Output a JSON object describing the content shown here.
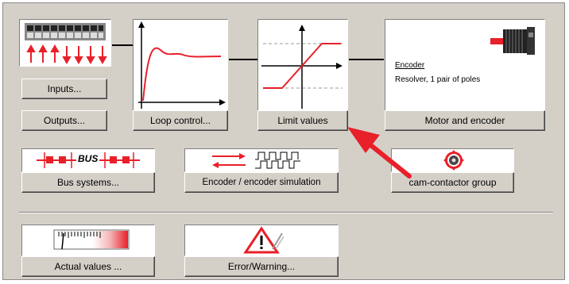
{
  "buttons": {
    "inputs": "Inputs...",
    "outputs": "Outputs...",
    "loop_control": "Loop control...",
    "limit_values": "Limit values",
    "motor_and_encoder": "Motor and encoder",
    "bus_systems": "Bus systems...",
    "encoder_simulation": "Encoder / encoder simulation",
    "cam_contactor_group": "cam-contactor group",
    "actual_values": "Actual values ...",
    "error_warning": "Error/Warning..."
  },
  "motor_panel": {
    "encoder_heading": "Encoder",
    "encoder_type": "Resolver, 1 pair of poles"
  },
  "bus_icon_label": "BUS",
  "icons": [
    "io-terminal-icon",
    "loop-response-graph-icon",
    "limit-graph-icon",
    "motor-icon",
    "bus-icon",
    "encoder-signal-icon",
    "cam-icon",
    "gauge-icon",
    "warning-triangle-icon",
    "red-arrow-icon"
  ],
  "colors": {
    "accent_red": "#e8202a",
    "window_bg": "#d4d0c8"
  }
}
